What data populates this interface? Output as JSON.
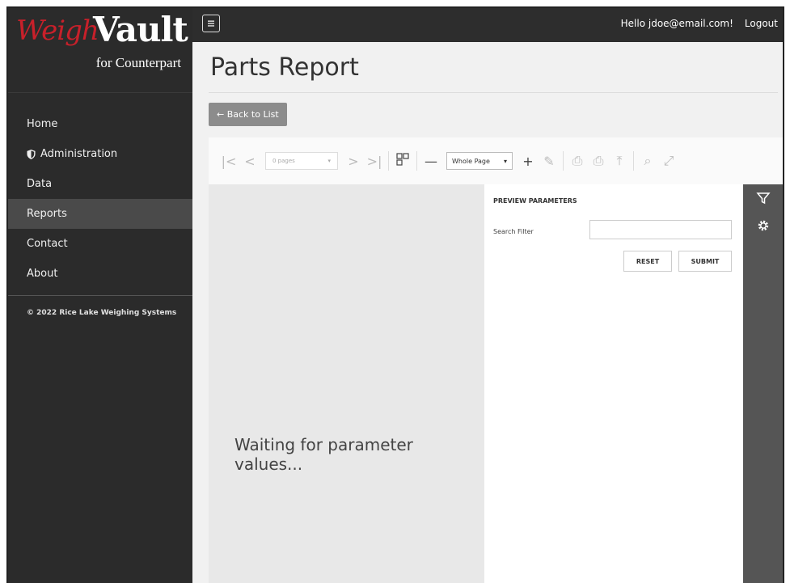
{
  "brand": {
    "weigh": "Weigh",
    "vault": "Vault",
    "sub": "for Counterpart",
    "accent_color": "#c8202a"
  },
  "sidebar": {
    "items": [
      {
        "label": "Home",
        "active": false
      },
      {
        "label": "Administration",
        "icon": "shield-icon",
        "active": false
      },
      {
        "label": "Data",
        "active": false
      },
      {
        "label": "Reports",
        "active": true
      },
      {
        "label": "Contact",
        "active": false
      },
      {
        "label": "About",
        "active": false
      }
    ],
    "copyright": "© 2022 Rice Lake Weighing Systems"
  },
  "topbar": {
    "greeting": "Hello jdoe@email.com!",
    "logout": "Logout"
  },
  "main": {
    "title": "Parts Report",
    "back_label": "← Back to List"
  },
  "viewer": {
    "pages_select": "0 pages",
    "zoom_select": "Whole Page",
    "waiting_text": "Waiting for parameter values...",
    "params": {
      "title": "PREVIEW PARAMETERS",
      "search_label": "Search Filter",
      "search_value": "",
      "reset": "RESET",
      "submit": "SUBMIT"
    }
  }
}
